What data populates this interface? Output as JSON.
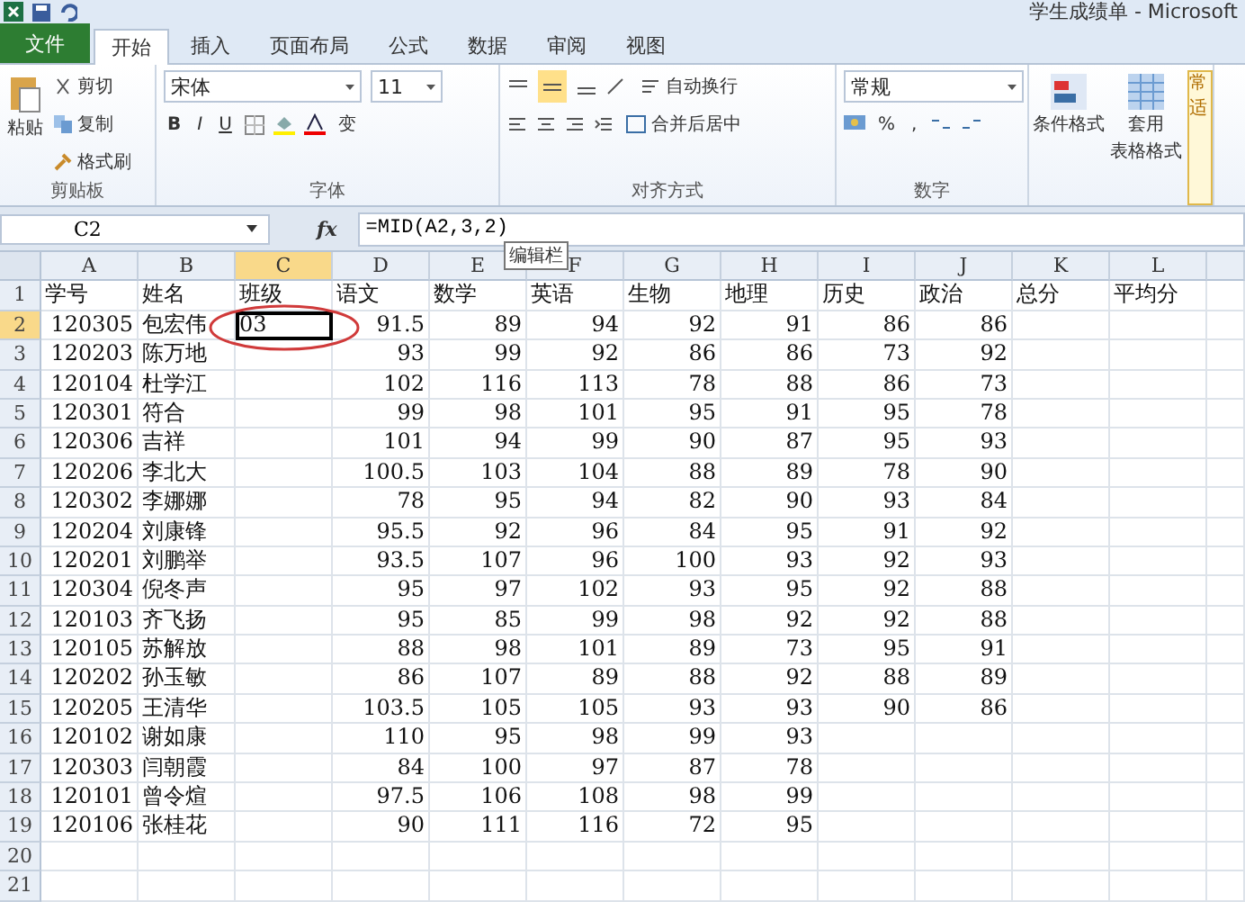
{
  "window": {
    "title": "学生成绩单 - Microsoft"
  },
  "tabs": [
    {
      "label": "文件",
      "kind": "file",
      "selected": false
    },
    {
      "label": "开始",
      "kind": "tab",
      "selected": true
    },
    {
      "label": "插入",
      "kind": "tab",
      "selected": false
    },
    {
      "label": "页面布局",
      "kind": "tab",
      "selected": false
    },
    {
      "label": "公式",
      "kind": "tab",
      "selected": false
    },
    {
      "label": "数据",
      "kind": "tab",
      "selected": false
    },
    {
      "label": "审阅",
      "kind": "tab",
      "selected": false
    },
    {
      "label": "视图",
      "kind": "tab",
      "selected": false
    }
  ],
  "ribbon": {
    "clipboard": {
      "paste": "粘贴",
      "cut": "剪切",
      "copy": "复制",
      "painter": "格式刷",
      "label": "剪贴板"
    },
    "font": {
      "name": "宋体",
      "size": "11",
      "bold": "B",
      "italic": "I",
      "underline": "U",
      "phonetic": "变",
      "label": "字体"
    },
    "alignment": {
      "wrap": "自动换行",
      "merge": "合并后居中",
      "label": "对齐方式"
    },
    "number": {
      "format": "常规",
      "percent": "%",
      "comma": ",",
      "label": "数字"
    },
    "styles": {
      "conditional": "条件格式",
      "table_line1": "套用",
      "table_line2": "表格格式",
      "cell_styles_top": "常",
      "cell_styles_bottom": "适"
    }
  },
  "formula_bar": {
    "name_box": "C2",
    "fx": "fx",
    "formula": "=MID(A2,3,2)",
    "tooltip": "编辑栏"
  },
  "columns": [
    {
      "letter": "A",
      "left_aligned": false,
      "selected": false
    },
    {
      "letter": "B",
      "left_aligned": true,
      "selected": false
    },
    {
      "letter": "C",
      "left_aligned": true,
      "selected": true
    },
    {
      "letter": "D",
      "left_aligned": false,
      "selected": false
    },
    {
      "letter": "E",
      "left_aligned": false,
      "selected": false
    },
    {
      "letter": "F",
      "left_aligned": false,
      "selected": false
    },
    {
      "letter": "G",
      "left_aligned": false,
      "selected": false
    },
    {
      "letter": "H",
      "left_aligned": false,
      "selected": false
    },
    {
      "letter": "I",
      "left_aligned": false,
      "selected": false
    },
    {
      "letter": "J",
      "left_aligned": false,
      "selected": false
    },
    {
      "letter": "K",
      "selected": false
    },
    {
      "letter": "L",
      "selected": false
    }
  ],
  "rows": [
    {
      "number": "1",
      "kind": "header",
      "selected": false,
      "cells": {
        "A": "学号",
        "B": "姓名",
        "C": "班级",
        "D": "语文",
        "E": "数学",
        "F": "英语",
        "G": "生物",
        "H": "地理",
        "I": "历史",
        "J": "政治",
        "K": "总分",
        "L": "平均分"
      }
    },
    {
      "number": "2",
      "kind": "data",
      "selected": true,
      "cells": {
        "A": "120305",
        "B": "包宏伟",
        "C": "03",
        "D": "91.5",
        "E": "89",
        "F": "94",
        "G": "92",
        "H": "91",
        "I": "86",
        "J": "86"
      }
    },
    {
      "number": "3",
      "kind": "data",
      "selected": false,
      "cells": {
        "A": "120203",
        "B": "陈万地",
        "D": "93",
        "E": "99",
        "F": "92",
        "G": "86",
        "H": "86",
        "I": "73",
        "J": "92"
      }
    },
    {
      "number": "4",
      "kind": "data",
      "selected": false,
      "cells": {
        "A": "120104",
        "B": "杜学江",
        "D": "102",
        "E": "116",
        "F": "113",
        "G": "78",
        "H": "88",
        "I": "86",
        "J": "73"
      }
    },
    {
      "number": "5",
      "kind": "data",
      "selected": false,
      "cells": {
        "A": "120301",
        "B": "符合",
        "D": "99",
        "E": "98",
        "F": "101",
        "G": "95",
        "H": "91",
        "I": "95",
        "J": "78"
      }
    },
    {
      "number": "6",
      "kind": "data",
      "selected": false,
      "cells": {
        "A": "120306",
        "B": "吉祥",
        "D": "101",
        "E": "94",
        "F": "99",
        "G": "90",
        "H": "87",
        "I": "95",
        "J": "93"
      }
    },
    {
      "number": "7",
      "kind": "data",
      "selected": false,
      "cells": {
        "A": "120206",
        "B": "李北大",
        "D": "100.5",
        "E": "103",
        "F": "104",
        "G": "88",
        "H": "89",
        "I": "78",
        "J": "90"
      }
    },
    {
      "number": "8",
      "kind": "data",
      "selected": false,
      "cells": {
        "A": "120302",
        "B": "李娜娜",
        "D": "78",
        "E": "95",
        "F": "94",
        "G": "82",
        "H": "90",
        "I": "93",
        "J": "84"
      }
    },
    {
      "number": "9",
      "kind": "data",
      "selected": false,
      "cells": {
        "A": "120204",
        "B": "刘康锋",
        "D": "95.5",
        "E": "92",
        "F": "96",
        "G": "84",
        "H": "95",
        "I": "91",
        "J": "92"
      }
    },
    {
      "number": "10",
      "kind": "data",
      "selected": false,
      "cells": {
        "A": "120201",
        "B": "刘鹏举",
        "D": "93.5",
        "E": "107",
        "F": "96",
        "G": "100",
        "H": "93",
        "I": "92",
        "J": "93"
      }
    },
    {
      "number": "11",
      "kind": "data",
      "selected": false,
      "cells": {
        "A": "120304",
        "B": "倪冬声",
        "D": "95",
        "E": "97",
        "F": "102",
        "G": "93",
        "H": "95",
        "I": "92",
        "J": "88"
      }
    },
    {
      "number": "12",
      "kind": "data",
      "selected": false,
      "cells": {
        "A": "120103",
        "B": "齐飞扬",
        "D": "95",
        "E": "85",
        "F": "99",
        "G": "98",
        "H": "92",
        "I": "92",
        "J": "88"
      }
    },
    {
      "number": "13",
      "kind": "data",
      "selected": false,
      "cells": {
        "A": "120105",
        "B": "苏解放",
        "D": "88",
        "E": "98",
        "F": "101",
        "G": "89",
        "H": "73",
        "I": "95",
        "J": "91"
      }
    },
    {
      "number": "14",
      "kind": "data",
      "selected": false,
      "cells": {
        "A": "120202",
        "B": "孙玉敏",
        "D": "86",
        "E": "107",
        "F": "89",
        "G": "88",
        "H": "92",
        "I": "88",
        "J": "89"
      }
    },
    {
      "number": "15",
      "kind": "data",
      "selected": false,
      "cells": {
        "A": "120205",
        "B": "王清华",
        "D": "103.5",
        "E": "105",
        "F": "105",
        "G": "93",
        "H": "93",
        "I": "90",
        "J": "86"
      }
    },
    {
      "number": "16",
      "kind": "data",
      "selected": false,
      "cells": {
        "A": "120102",
        "B": "谢如康",
        "D": "110",
        "E": "95",
        "F": "98",
        "G": "99",
        "H": "93"
      }
    },
    {
      "number": "17",
      "kind": "data",
      "selected": false,
      "cells": {
        "A": "120303",
        "B": "闫朝霞",
        "D": "84",
        "E": "100",
        "F": "97",
        "G": "87",
        "H": "78"
      }
    },
    {
      "number": "18",
      "kind": "data",
      "selected": false,
      "cells": {
        "A": "120101",
        "B": "曾令煊",
        "D": "97.5",
        "E": "106",
        "F": "108",
        "G": "98",
        "H": "99"
      }
    },
    {
      "number": "19",
      "kind": "data",
      "selected": false,
      "cells": {
        "A": "120106",
        "B": "张桂花",
        "D": "90",
        "E": "111",
        "F": "116",
        "G": "72",
        "H": "95"
      }
    },
    {
      "number": "20",
      "kind": "data",
      "selected": false,
      "cells": {}
    },
    {
      "number": "21",
      "kind": "data",
      "selected": false,
      "cells": {}
    }
  ]
}
